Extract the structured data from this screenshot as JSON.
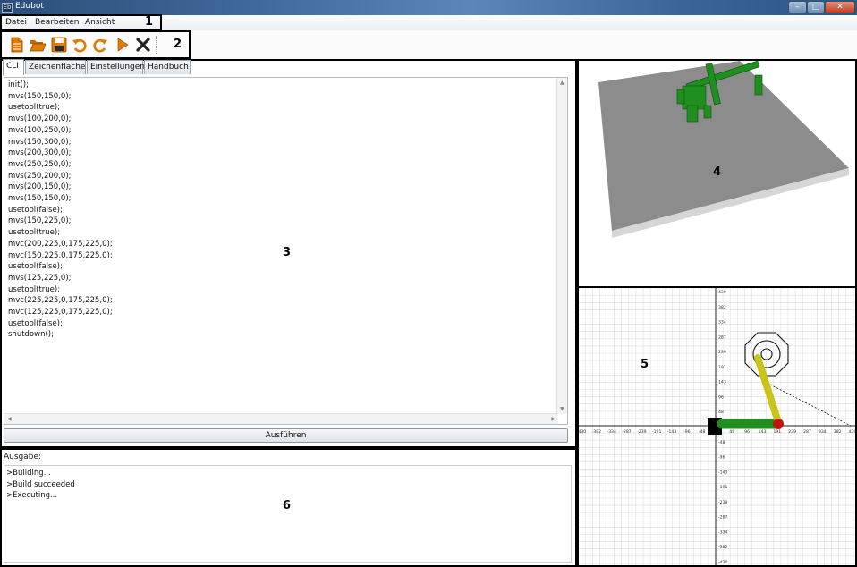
{
  "window": {
    "title": "Edubot",
    "app_icon_text": "Eb",
    "controls": {
      "minimize": "–",
      "maximize": "□",
      "close": "✕"
    }
  },
  "menu": {
    "items": [
      "Datei",
      "Bearbeiten",
      "Ansicht"
    ]
  },
  "toolbar": {
    "buttons": [
      {
        "name": "new-file-icon",
        "color": "#e37b00"
      },
      {
        "name": "open-folder-icon",
        "color": "#e37b00"
      },
      {
        "name": "save-icon",
        "color": "#e37b00"
      },
      {
        "name": "undo-icon",
        "color": "#e37b00"
      },
      {
        "name": "redo-icon",
        "color": "#e37b00"
      },
      {
        "name": "run-icon",
        "color": "#e37b00"
      },
      {
        "name": "stop-icon",
        "color": "#222222"
      }
    ]
  },
  "annotations": {
    "a1": "1",
    "a2": "2",
    "a3": "3",
    "a4": "4",
    "a5": "5",
    "a6": "6"
  },
  "tabs": [
    "CLI",
    "Zeichenfläche",
    "Einstellungen",
    "Handbuch"
  ],
  "active_tab": "CLI",
  "editor": {
    "code": "init();\nmvs(150,150,0);\nusetool(true);\nmvs(100,200,0);\nmvs(100,250,0);\nmvs(150,300,0);\nmvs(200,300,0);\nmvs(250,250,0);\nmvs(250,200,0);\nmvs(200,150,0);\nmvs(150,150,0);\nusetool(false);\nmvs(150,225,0);\nusetool(true);\nmvc(200,225,0,175,225,0);\nmvc(150,225,0,175,225,0);\nusetool(false);\nmvs(125,225,0);\nusetool(true);\nmvc(225,225,0,175,225,0);\nmvc(125,225,0,175,225,0);\nusetool(false);\nshutdown();"
  },
  "run_button": "Ausführen",
  "output": {
    "label": "Ausgabe:",
    "lines": ">Building...\n>Build succeeded\n>Executing..."
  },
  "colors": {
    "accent_orange": "#e37b00",
    "robot_green": "#1f8f1f",
    "robot_yellow": "#c9c41a",
    "joint_red": "#c0140f",
    "plate_gray": "#8c8c8c"
  },
  "plot2d": {
    "x_ticks": [
      "-430",
      "-382",
      "-334",
      "-287",
      "-239",
      "-191",
      "-143",
      "-96",
      "-48",
      "0",
      "48",
      "96",
      "143",
      "191",
      "239",
      "287",
      "334",
      "382",
      "430"
    ],
    "y_ticks": [
      "430",
      "382",
      "334",
      "287",
      "239",
      "191",
      "143",
      "96",
      "48",
      "0",
      "-48",
      "-96",
      "-143",
      "-191",
      "-239",
      "-287",
      "-334",
      "-382",
      "-430"
    ]
  }
}
